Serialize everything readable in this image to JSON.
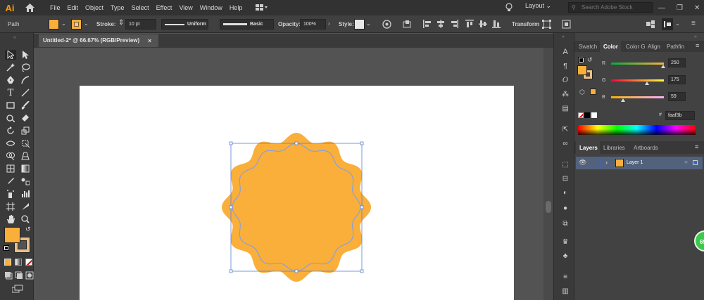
{
  "app": {
    "logo": "Ai",
    "menus": [
      "File",
      "Edit",
      "Object",
      "Type",
      "Select",
      "Effect",
      "View",
      "Window",
      "Help"
    ],
    "workspace": "Layout",
    "search_placeholder": "Search Adobe Stock"
  },
  "control_bar": {
    "selection_label": "Path",
    "fill_color": "#faaf3b",
    "stroke_label": "Stroke:",
    "stroke_weight": "10 pt",
    "profile": "Uniform",
    "brush": "Basic",
    "opacity_label": "Opacity:",
    "opacity_value": "100%",
    "style_label": "Style:",
    "transform_label": "Transform"
  },
  "document": {
    "tab_title": "Untitled-2* @ 66.67% (RGB/Preview)",
    "close_label": "×",
    "shape_color": "#faaf3b",
    "selection_color": "#5b7fd6"
  },
  "color_panel": {
    "tabs": [
      "Swatch",
      "Color",
      "Color G",
      "Align",
      "Pathfin"
    ],
    "active_tab": "Color",
    "r_label": "R",
    "g_label": "G",
    "b_label": "B",
    "r": 250,
    "g": 175,
    "b": 59,
    "r_value": "250",
    "g_value": "175",
    "b_value": "59",
    "hex_label": "#",
    "hex": "faaf3b"
  },
  "layers_panel": {
    "tabs": [
      "Layers",
      "Libraries",
      "Artboards"
    ],
    "active_tab": "Layers",
    "layers": [
      {
        "name": "Layer 1"
      }
    ]
  },
  "badge": {
    "text": "69"
  }
}
